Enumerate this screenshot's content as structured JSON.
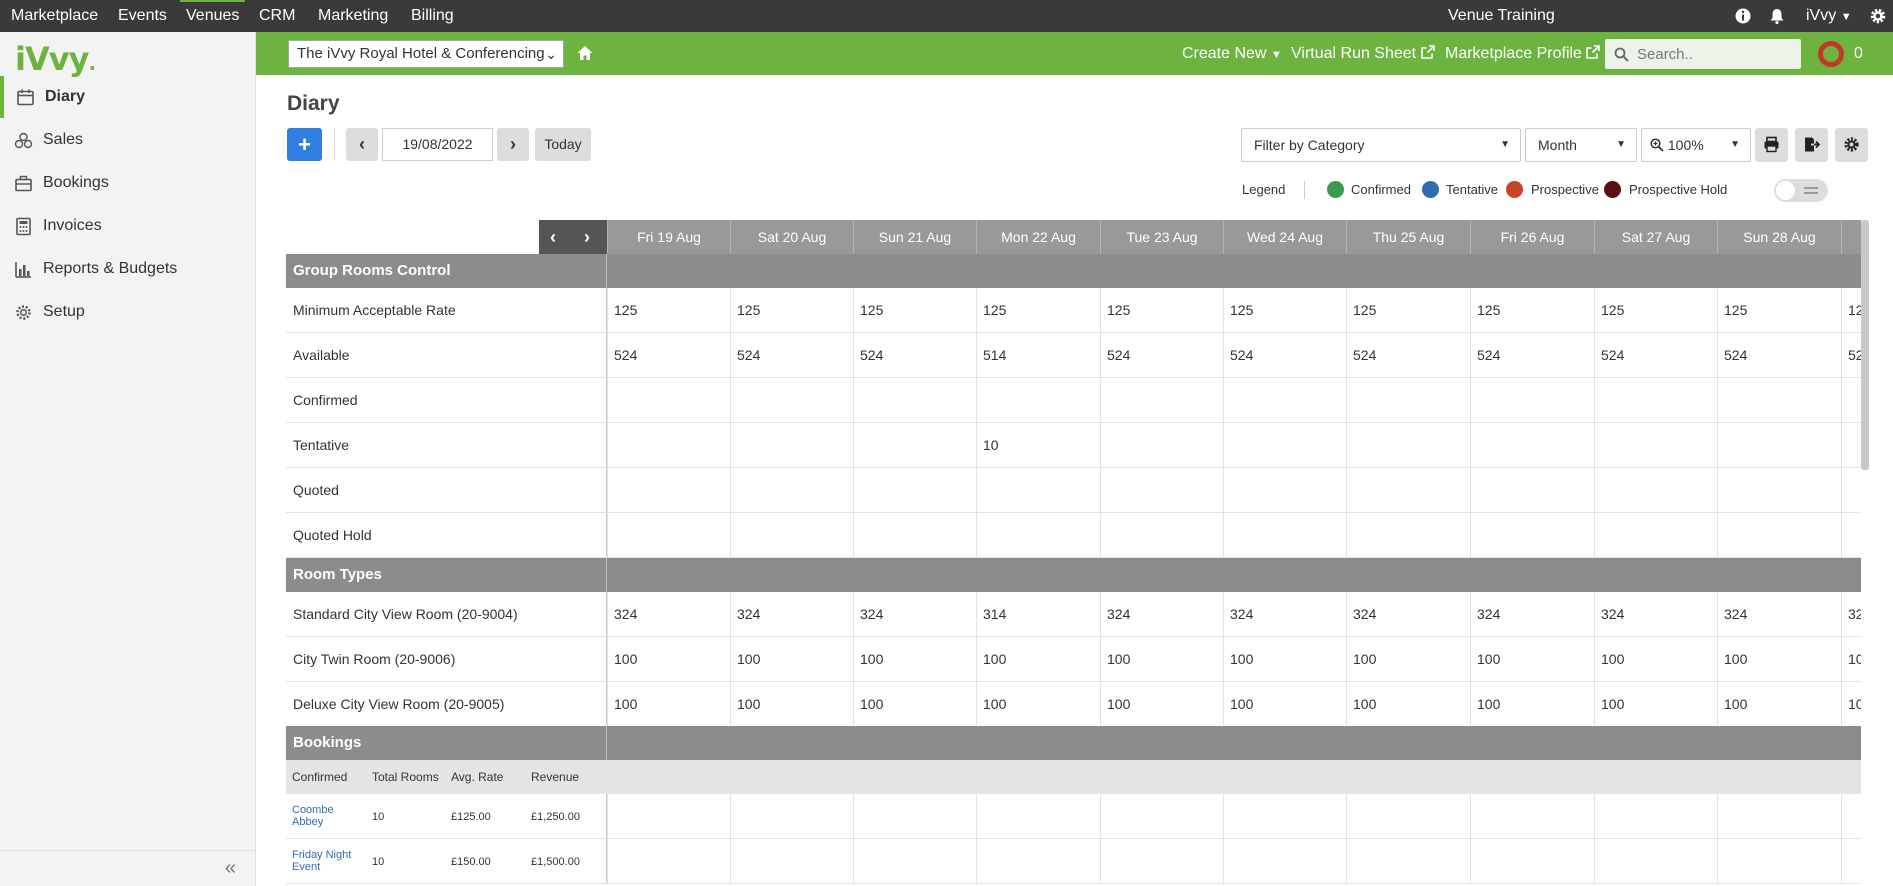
{
  "topnav": {
    "items": [
      "Marketplace",
      "Events",
      "Venues",
      "CRM",
      "Marketing",
      "Billing"
    ],
    "center_title": "Venue Training",
    "user": "iVvy"
  },
  "sidebar": {
    "logo": "iVvy",
    "items": [
      {
        "label": "Diary",
        "icon": "calendar-icon"
      },
      {
        "label": "Sales",
        "icon": "sales-icon"
      },
      {
        "label": "Bookings",
        "icon": "briefcase-icon"
      },
      {
        "label": "Invoices",
        "icon": "calculator-icon"
      },
      {
        "label": "Reports & Budgets",
        "icon": "bar-chart-icon"
      },
      {
        "label": "Setup",
        "icon": "gear-icon"
      }
    ],
    "collapse": "«"
  },
  "greenbar": {
    "venue": "The iVvy Royal Hotel & Conferencing",
    "create_new": "Create New",
    "virtual_run_sheet": "Virtual Run Sheet",
    "marketplace_profile": "Marketplace Profile",
    "search_placeholder": "Search..",
    "notification_count": "0"
  },
  "page": {
    "title": "Diary",
    "date": "19/08/2022",
    "today": "Today",
    "filter": "Filter by Category",
    "view": "Month",
    "zoom": "100%"
  },
  "legend": {
    "title": "Legend",
    "items": [
      {
        "label": "Confirmed",
        "color": "#3c9a4f"
      },
      {
        "label": "Tentative",
        "color": "#2f6db3"
      },
      {
        "label": "Prospective",
        "color": "#c8452a"
      },
      {
        "label": "Prospective Hold",
        "color": "#5a1010"
      }
    ]
  },
  "grid": {
    "days": [
      "Fri 19 Aug",
      "Sat 20 Aug",
      "Sun 21 Aug",
      "Mon 22 Aug",
      "Tue 23 Aug",
      "Wed 24 Aug",
      "Thu 25 Aug",
      "Fri 26 Aug",
      "Sat 27 Aug",
      "Sun 28 Aug"
    ],
    "sections": [
      {
        "title": "Group Rooms Control",
        "rows": [
          {
            "label": "Minimum Acceptable Rate",
            "values": [
              "125",
              "125",
              "125",
              "125",
              "125",
              "125",
              "125",
              "125",
              "125",
              "125",
              "12"
            ]
          },
          {
            "label": "Available",
            "values": [
              "524",
              "524",
              "524",
              "514",
              "524",
              "524",
              "524",
              "524",
              "524",
              "524",
              "52"
            ]
          },
          {
            "label": "Confirmed",
            "values": [
              "",
              "",
              "",
              "",
              "",
              "",
              "",
              "",
              "",
              "",
              ""
            ]
          },
          {
            "label": "Tentative",
            "values": [
              "",
              "",
              "",
              "10",
              "",
              "",
              "",
              "",
              "",
              "",
              ""
            ]
          },
          {
            "label": "Quoted",
            "values": [
              "",
              "",
              "",
              "",
              "",
              "",
              "",
              "",
              "",
              "",
              ""
            ]
          },
          {
            "label": "Quoted Hold",
            "values": [
              "",
              "",
              "",
              "",
              "",
              "",
              "",
              "",
              "",
              "",
              ""
            ]
          }
        ]
      },
      {
        "title": "Room Types",
        "rows": [
          {
            "label": "Standard City View Room (20-9004)",
            "values": [
              "324",
              "324",
              "324",
              "314",
              "324",
              "324",
              "324",
              "324",
              "324",
              "324",
              "32"
            ]
          },
          {
            "label": "City Twin Room (20-9006)",
            "values": [
              "100",
              "100",
              "100",
              "100",
              "100",
              "100",
              "100",
              "100",
              "100",
              "100",
              "10"
            ]
          },
          {
            "label": "Deluxe City View Room (20-9005)",
            "values": [
              "100",
              "100",
              "100",
              "100",
              "100",
              "100",
              "100",
              "100",
              "100",
              "100",
              "10"
            ]
          }
        ]
      }
    ],
    "bookings": {
      "title": "Bookings",
      "columns": [
        "Confirmed",
        "Total Rooms",
        "Avg. Rate",
        "Revenue"
      ],
      "rows": [
        {
          "name": "Coombe Abbey",
          "total": "10",
          "rate": "£125.00",
          "revenue": "£1,250.00"
        },
        {
          "name": "Friday Night Event",
          "total": "10",
          "rate": "£150.00",
          "revenue": "£1,500.00"
        }
      ]
    }
  }
}
